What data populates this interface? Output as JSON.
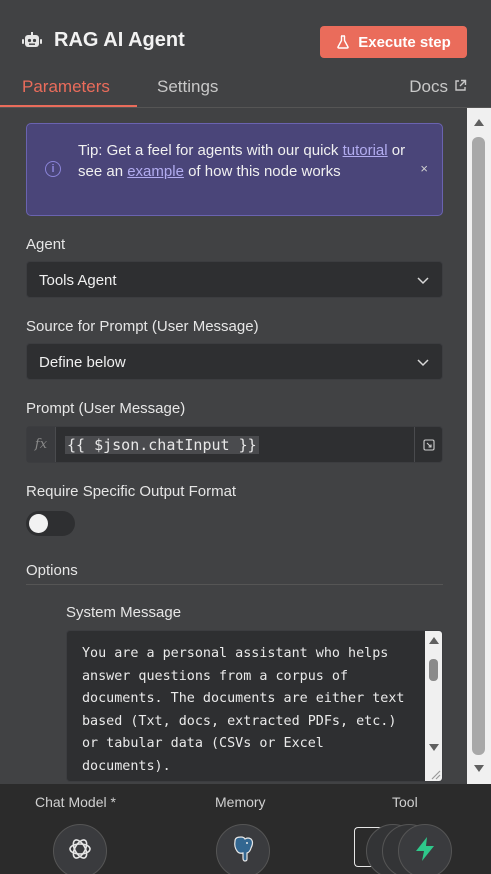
{
  "header": {
    "title": "RAG AI Agent",
    "icon": "robot-icon",
    "execute_label": "Execute step"
  },
  "tabs": {
    "parameters": "Parameters",
    "settings": "Settings",
    "docs": "Docs",
    "active": "Parameters"
  },
  "tip": {
    "text_1": "Tip: Get a feel for agents with our quick ",
    "link_tutorial": "tutorial",
    "text_2": " or see an ",
    "link_example": "example",
    "text_3": " of how this node works",
    "close": "×"
  },
  "fields": {
    "agent_label": "Agent",
    "agent_value": "Tools Agent",
    "source_label": "Source for Prompt (User Message)",
    "source_value": "Define below",
    "prompt_label": "Prompt (User Message)",
    "prompt_fx": "fx",
    "prompt_value": "{{ $json.chatInput }}",
    "require_label": "Require Specific Output Format",
    "require_enabled": false
  },
  "options": {
    "title": "Options",
    "system_message_label": "System Message",
    "system_message_value": "You are a personal assistant who helps answer questions from a corpus of documents. The documents are either text based (Txt, docs, extracted PDFs, etc.) or tabular data (CSVs or Excel documents)."
  },
  "bottom": {
    "chat_model_label": "Chat Model *",
    "memory_label": "Memory",
    "tool_label": "Tool"
  },
  "colors": {
    "accent": "#ea6c5b",
    "panel": "#414244",
    "tip_bg": "#4a4579",
    "tool_icon": "#2ec88a"
  }
}
